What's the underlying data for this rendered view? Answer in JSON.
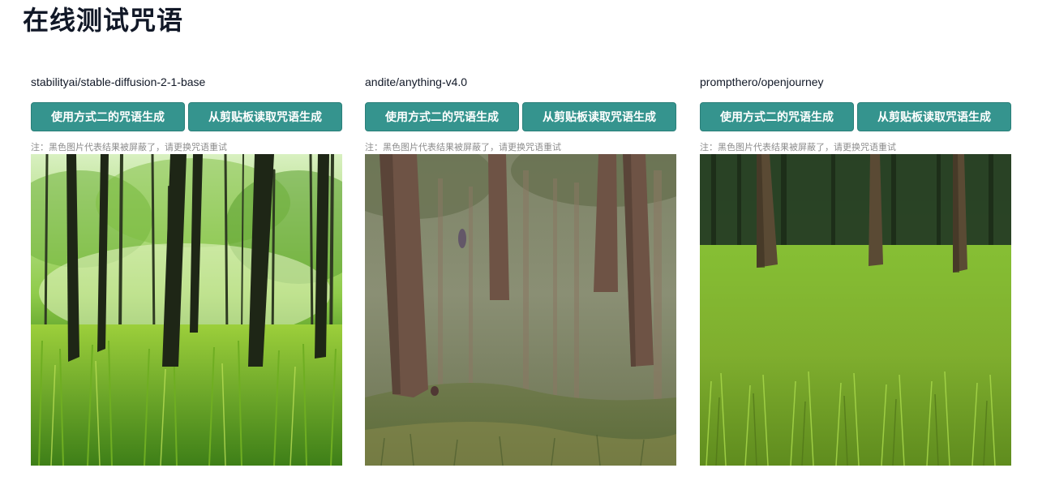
{
  "page": {
    "title": "在线测试咒语"
  },
  "cards": [
    {
      "model": "stabilityai/stable-diffusion-2-1-base",
      "buttons": [
        "使用方式二的咒语生成",
        "从剪贴板读取咒语生成"
      ],
      "note": "注：黑色图片代表结果被屏蔽了，请更换咒语重试"
    },
    {
      "model": "andite/anything-v4.0",
      "buttons": [
        "使用方式二的咒语生成",
        "从剪贴板读取咒语生成"
      ],
      "note": "注：黑色图片代表结果被屏蔽了，请更换咒语重试"
    },
    {
      "model": "prompthero/openjourney",
      "buttons": [
        "使用方式二的咒语生成",
        "从剪贴板读取咒语生成"
      ],
      "note": "注：黑色图片代表结果被屏蔽了，请更换咒语重试"
    }
  ],
  "colors": {
    "button_bg": "#35948e",
    "button_text": "#ffffff",
    "note_text": "#8c8c8c"
  }
}
